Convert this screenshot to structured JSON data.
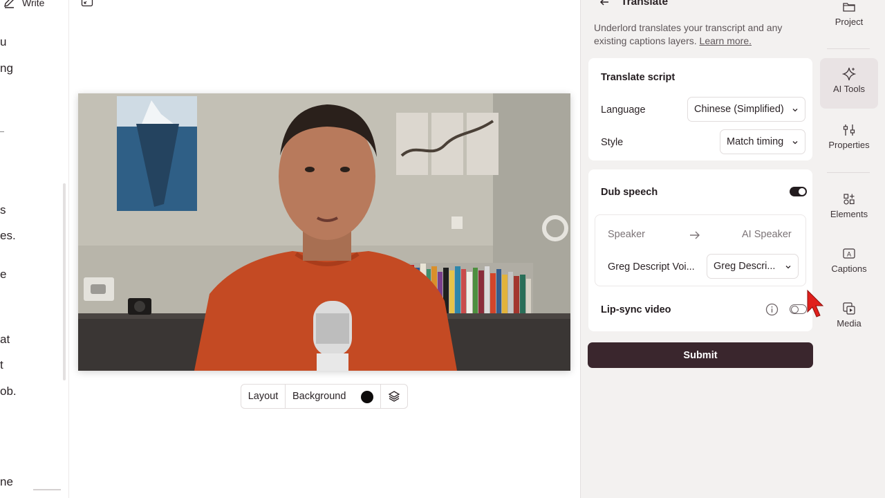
{
  "script": {
    "write_label": "Write",
    "fragments": [
      "u",
      "ng",
      "s",
      "es.",
      "e",
      "at",
      "t",
      "ob.",
      "ne"
    ]
  },
  "canvas": {
    "toolbar": {
      "layout_label": "Layout",
      "background_label": "Background",
      "background_color": "#0d0b0b"
    }
  },
  "panel": {
    "title": "Translate",
    "description": "Underlord translates your transcript and any existing captions layers.",
    "learn_more": "Learn more.",
    "translate_card": {
      "title": "Translate script",
      "language_label": "Language",
      "language_value": "Chinese (Simplified)",
      "style_label": "Style",
      "style_value": "Match timing"
    },
    "dub_card": {
      "title": "Dub speech",
      "dub_enabled": true,
      "speaker_header": "Speaker",
      "ai_speaker_header": "AI Speaker",
      "speaker_name": "Greg Descript Voi...",
      "ai_speaker_value": "Greg Descri...",
      "lipsync_label": "Lip-sync video",
      "lipsync_enabled": false
    },
    "submit_label": "Submit"
  },
  "rail": {
    "items": [
      {
        "label": "Project",
        "icon": "folder-icon"
      },
      {
        "label": "AI Tools",
        "icon": "sparkle-icon",
        "active": true
      },
      {
        "label": "Properties",
        "icon": "sliders-icon"
      },
      {
        "label": "Elements",
        "icon": "shapes-icon"
      },
      {
        "label": "Captions",
        "icon": "captions-icon"
      },
      {
        "label": "Media",
        "icon": "media-icon"
      }
    ]
  },
  "colors": {
    "accent_dark": "#3a262d",
    "panel_bg": "#f3f1f0",
    "active_rail_bg": "#e9e3e4",
    "cursor_red": "#e0201c"
  }
}
